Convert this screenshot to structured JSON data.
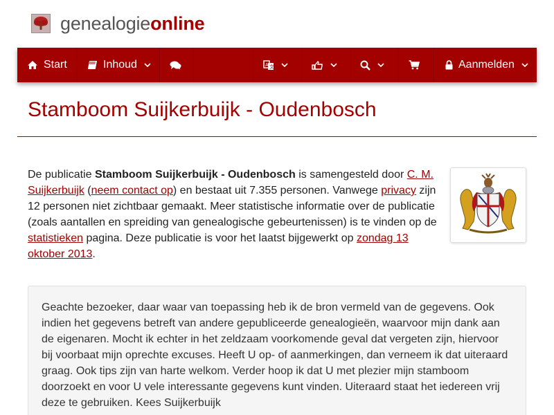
{
  "logo": {
    "part1": "genealogie",
    "part2": "online"
  },
  "nav": {
    "start": "Start",
    "inhoud": "Inhoud",
    "aanmelden": "Aanmelden"
  },
  "title": "Stamboom Suijkerbuijk - Oudenbosch",
  "intro": {
    "t1": "De publicatie ",
    "pub_name": "Stamboom Suijkerbuijk - Oudenbosch",
    "t2": " is samengesteld door ",
    "author": "C. M. Suijkerbuijk",
    "t3": " (",
    "contact": "neem contact op",
    "t4": ") en bestaat uit 7.355 personen. Vanwege ",
    "privacy": "privacy",
    "t5": " zijn 12 personen niet zichtbaar gemaakt. Meer statistische informatie over de publicatie (zoals aantallen en spreiding van genealogische gebeurtenissen) is te vinden op de ",
    "stats": "statistieken",
    "t6": " pagina. Deze publicatie is voor het laatst bijgewerkt op ",
    "date": "zondag 13 oktober 2013",
    "t7": "."
  },
  "message": "Geachte bezoeker, daar waar van toepassing heb ik de bron vermeld van de gegevens. Ook indien het gegevens betreft van andere gepubliceerde genealogieën, waarvoor mijn dank aan de eigenaren. Mocht ik echter in het zeldzaam voorkomende geval dat vergeten zijn, hiervoor bij voorbaat mijn oprechte excuses. Heeft U op- of aanmerkingen, dan verneem ik dat uiteraard graag. Ook tips zijn van harte welkom. Verder hoop ik dat U met plezier mijn stamboom doorzoekt en voor U vele interessante gegevens kunt vinden. Uiteraard staat het iedereen vrij deze te gebruiken. Kees Suijkerbuijk",
  "icons": {
    "logo": "tree-icon",
    "start": "home-icon",
    "inhoud": "book-icon",
    "chat": "comments-icon",
    "language": "translate-icon",
    "share": "share-icon",
    "search": "search-icon",
    "cart": "cart-icon",
    "lock": "lock-icon",
    "caret": "chevron-down-icon"
  },
  "colors": {
    "brand": "#a30000",
    "panel": "#f5f5f5"
  }
}
